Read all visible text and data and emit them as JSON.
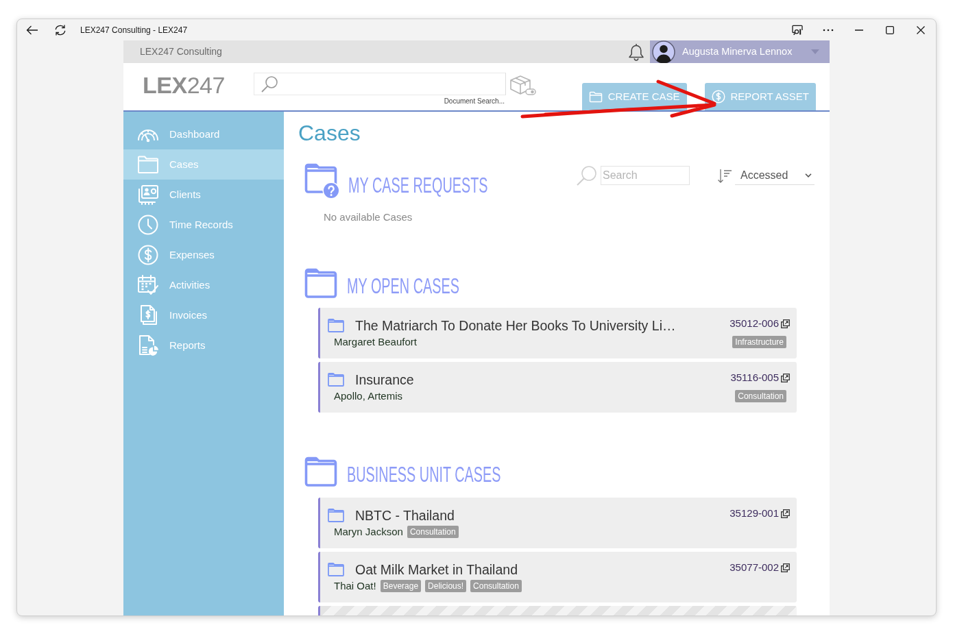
{
  "window": {
    "title": "LEX247 Consulting - LEX247"
  },
  "top_bar": {
    "organization": "LEX247 Consulting",
    "user_name": "Augusta Minerva Lennox"
  },
  "header": {
    "logo": "**LEX**247",
    "search_caption": "Document Search...",
    "buttons": [
      {
        "label": "CREATE CASE",
        "kind": "create"
      },
      {
        "label": "REPORT ASSET",
        "kind": "report"
      }
    ]
  },
  "sidebar": {
    "items": [
      {
        "label": "Dashboard",
        "selected": false
      },
      {
        "label": "Cases",
        "selected": true
      },
      {
        "label": "Clients",
        "selected": false
      },
      {
        "label": "Time Records",
        "selected": false
      },
      {
        "label": "Expenses",
        "selected": false
      },
      {
        "label": "Activities",
        "selected": false
      },
      {
        "label": "Invoices",
        "selected": false
      },
      {
        "label": "Reports",
        "selected": false
      }
    ]
  },
  "page_title": "Cases",
  "sections": [
    {
      "title": "MY CASE REQUESTS",
      "kind": "requests",
      "search": {
        "placeholder": "Search"
      },
      "sort": {
        "value": "Accessed"
      },
      "empty_text": "No available Cases"
    },
    {
      "title": "MY OPEN CASES",
      "kind": "cases",
      "tags_right": true,
      "cases": [
        {
          "title": "The Matriarch To Donate Her Books To University Li…",
          "number": "35012-006",
          "client": "Margaret Beaufort",
          "tags": [
            "Infrastructure"
          ]
        },
        {
          "title": "Insurance",
          "number": "35116-005",
          "client": "Apollo, Artemis",
          "tags": [
            "Consultation"
          ]
        }
      ]
    },
    {
      "title": "BUSINESS UNIT CASES",
      "kind": "cases",
      "tags_right": false,
      "partial_card": true,
      "cases": [
        {
          "title": "NBTC - Thailand",
          "number": "35129-001",
          "client": "Maryn Jackson",
          "tags": [
            "Consultation"
          ]
        },
        {
          "title": "Oat Milk Market in Thailand",
          "number": "35077-002",
          "client": "Thai Oat!",
          "tags": [
            "Beverage",
            "Delicious!",
            "Consultation"
          ]
        }
      ]
    }
  ]
}
